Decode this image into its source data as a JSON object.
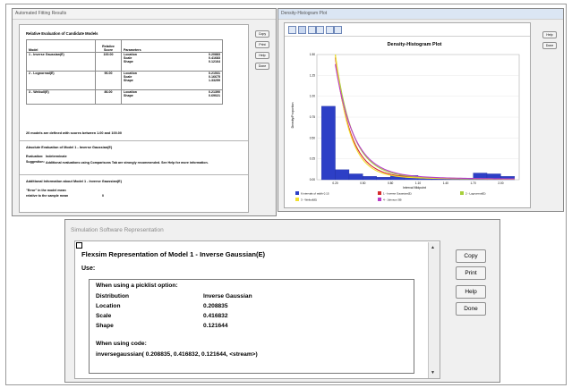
{
  "left_window": {
    "title": "Automated Fitting Results",
    "section_title": "Relative Evaluation of Candidate Models",
    "table": {
      "headers": [
        "Model",
        "Relative Score",
        "Parameters"
      ],
      "rows": [
        {
          "model": "1 - Inverse Gaussian(E)",
          "score": "100.00",
          "params": [
            [
              "Location",
              "0.20883"
            ],
            [
              "Scale",
              "0.41683"
            ],
            [
              "Shape",
              "0.12164"
            ]
          ]
        },
        {
          "model": "2 - Lognormal(E)",
          "score": "96.00",
          "params": [
            [
              "Location",
              "0.21531"
            ],
            [
              "Scale",
              "0.16675"
            ],
            [
              "Shape",
              "1.33259"
            ]
          ]
        },
        {
          "model": "3 - Weibull(E)",
          "score": "86.00",
          "params": [
            [
              "Location",
              "0.21390"
            ],
            [
              "Shape",
              "0.69021"
            ]
          ]
        }
      ]
    },
    "defined_note": "20 models are defined with scores between 1.00 and 100.00",
    "absolute_title": "Absolute Evaluation of Model 1 - Inverse Gaussian(E)",
    "evaluation_label": "Evaluation:",
    "evaluation_value": "Indeterminate",
    "suggestion_label": "Suggestion:",
    "suggestion_value": "Additional evaluations using Comparisons Tab are strongly recommended. See Help for more information.",
    "additional_title": "Additional Information about Model 1 - Inverse Gaussian(E)",
    "error_line1": "\"Error\" in the model mean",
    "error_line2": "relative to the sample mean",
    "error_value": "0",
    "buttons": {
      "copy": "Copy",
      "print": "Print",
      "help": "Help",
      "done": "Done"
    }
  },
  "right_window": {
    "title": "Density-Histogram Plot",
    "buttons": {
      "help": "Help",
      "done": "Done"
    }
  },
  "chart_data": {
    "type": "bar",
    "title": "Density-Histogram Plot",
    "xlabel": "Interval Midpoint",
    "ylabel": "Density/Proportion",
    "xlim": [
      0,
      2.2
    ],
    "ylim": [
      0,
      1.5
    ],
    "x_ticks": [
      "0.20",
      "0.50",
      "0.80",
      "1.10",
      "1.40",
      "1.70",
      "2.00"
    ],
    "y_ticks": [
      "0.00",
      "0.25",
      "0.50",
      "0.75",
      "1.00",
      "1.25",
      "1.50"
    ],
    "histogram": {
      "bins": [
        [
          0.05,
          0.2
        ],
        [
          0.2,
          0.35
        ],
        [
          0.35,
          0.5
        ],
        [
          0.5,
          0.65
        ],
        [
          0.65,
          0.8
        ],
        [
          0.8,
          0.95
        ],
        [
          0.95,
          1.1
        ],
        [
          1.1,
          1.25
        ],
        [
          1.25,
          1.4
        ],
        [
          1.4,
          1.55
        ],
        [
          1.55,
          1.7
        ],
        [
          1.7,
          1.85
        ],
        [
          1.85,
          2.0
        ],
        [
          2.0,
          2.15
        ]
      ],
      "heights": [
        0.88,
        0.12,
        0.07,
        0.04,
        0.03,
        0.05,
        0.05,
        0.02,
        0.01,
        0.01,
        0.02,
        0.08,
        0.07,
        0.04
      ],
      "color": "#2d3fc6"
    },
    "series": [
      {
        "name": "1 - Inverse Gaussian(E)",
        "color": "#d52b2b"
      },
      {
        "name": "2 - Lognormal(E)",
        "color": "#a7cf3b"
      },
      {
        "name": "3 - Weibull(E)",
        "color": "#f2e02e"
      },
      {
        "name": "4 - Johnson SB",
        "color": "#b93cc8"
      }
    ],
    "legend_first": "6 intervals of width 0.15",
    "legend_placement": "bottom"
  },
  "bottom_window": {
    "title": "Simulation Software Representation",
    "heading": "Flexsim Representation of Model 1 - Inverse Gaussian(E)",
    "use_label": "Use:",
    "picklist_title": "When using a picklist option:",
    "rows": [
      {
        "label": "Distribution",
        "value": "Inverse Gaussian"
      },
      {
        "label": "Location",
        "value": "0.208835"
      },
      {
        "label": "Scale",
        "value": "0.416832"
      },
      {
        "label": "Shape",
        "value": "0.121644"
      }
    ],
    "code_title": "When using code:",
    "code": "inversegaussian( 0.208835, 0.416832, 0.121644, <stream>)",
    "buttons": {
      "copy": "Copy",
      "print": "Print",
      "help": "Help",
      "done": "Done"
    }
  }
}
